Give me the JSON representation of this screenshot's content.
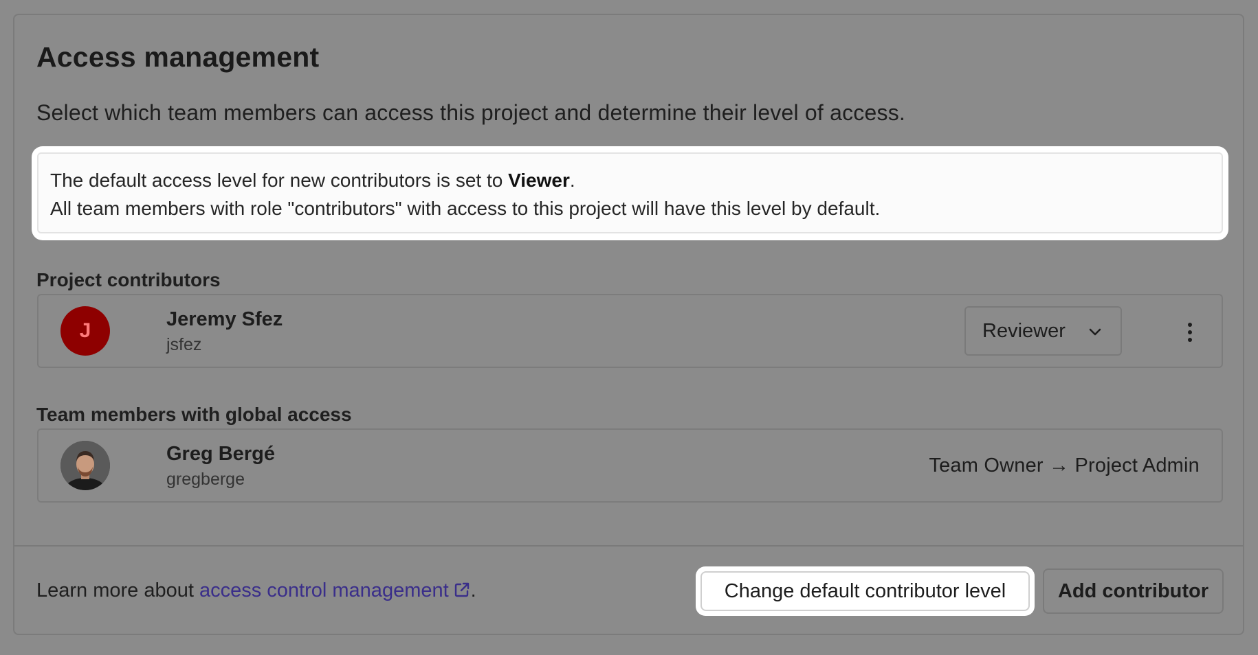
{
  "header": {
    "title": "Access management",
    "subtitle": "Select which team members can access this project and determine their level of access."
  },
  "notice": {
    "line1_prefix": "The default access level for new contributors is set to ",
    "default_level": "Viewer",
    "line1_suffix": ".",
    "line2": "All team members with role \"contributors\" with access to this project will have this level by default."
  },
  "contributors": {
    "label": "Project contributors",
    "items": [
      {
        "avatar_initial": "J",
        "avatar_color": "#8e0000",
        "name": "Jeremy Sfez",
        "handle": "jsfez",
        "role": "Reviewer"
      }
    ]
  },
  "global_access": {
    "label": "Team members with global access",
    "items": [
      {
        "name": "Greg Bergé",
        "handle": "gregberge",
        "role_mapping": "Team Owner → Project Admin"
      }
    ]
  },
  "footer": {
    "learn_prefix": "Learn more about ",
    "learn_link": "access control management",
    "learn_suffix": ".",
    "change_default_button": "Change default contributor level",
    "add_contributor_button": "Add contributor"
  },
  "colors": {
    "backdrop": "#8b8b8b",
    "link": "#3a2e8a",
    "avatar_red": "#8e0000"
  }
}
